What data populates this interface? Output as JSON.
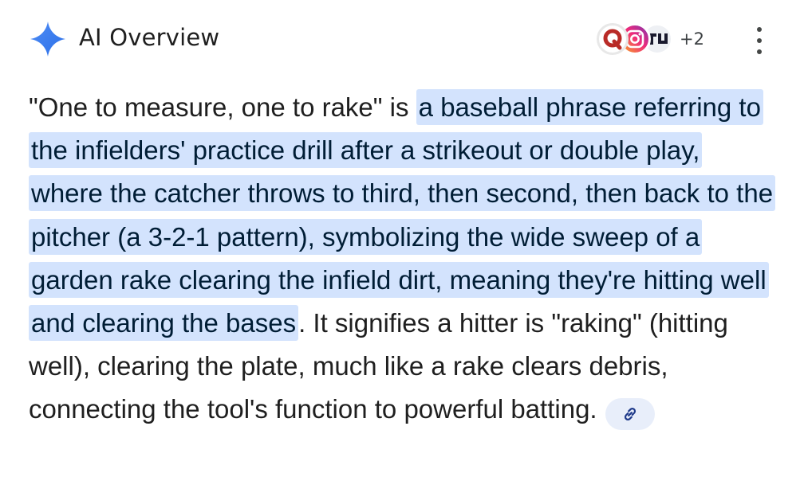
{
  "header": {
    "title": "AI Overview",
    "more_sources": "+2",
    "icons": {
      "spark": "gemini-spark-icon",
      "sources": [
        "quora-icon",
        "instagram-icon",
        "thread-source-icon"
      ],
      "menu": "more-vert-icon"
    }
  },
  "overview": {
    "intro": "\"One to measure, one to rake\" is ",
    "highlight": "a baseball phrase referring to the infielders' practice drill after a strikeout or double play, where the catcher throws to third, then second, then back to the pitcher (a 3-2-1 pattern), symbolizing the wide sweep of a garden rake clearing the infield dirt, meaning they're hitting well and clearing the bases",
    "rest": ". It signifies a hitter is \"raking\" (hitting well), clearing the plate, much like a rake clears debris, connecting the tool's function to powerful batting.",
    "link_icon": "link-icon"
  },
  "colors": {
    "highlight_bg": "#d3e3fd",
    "spark_blue": "#3b82f6",
    "chip_bg": "#e8eefa"
  }
}
